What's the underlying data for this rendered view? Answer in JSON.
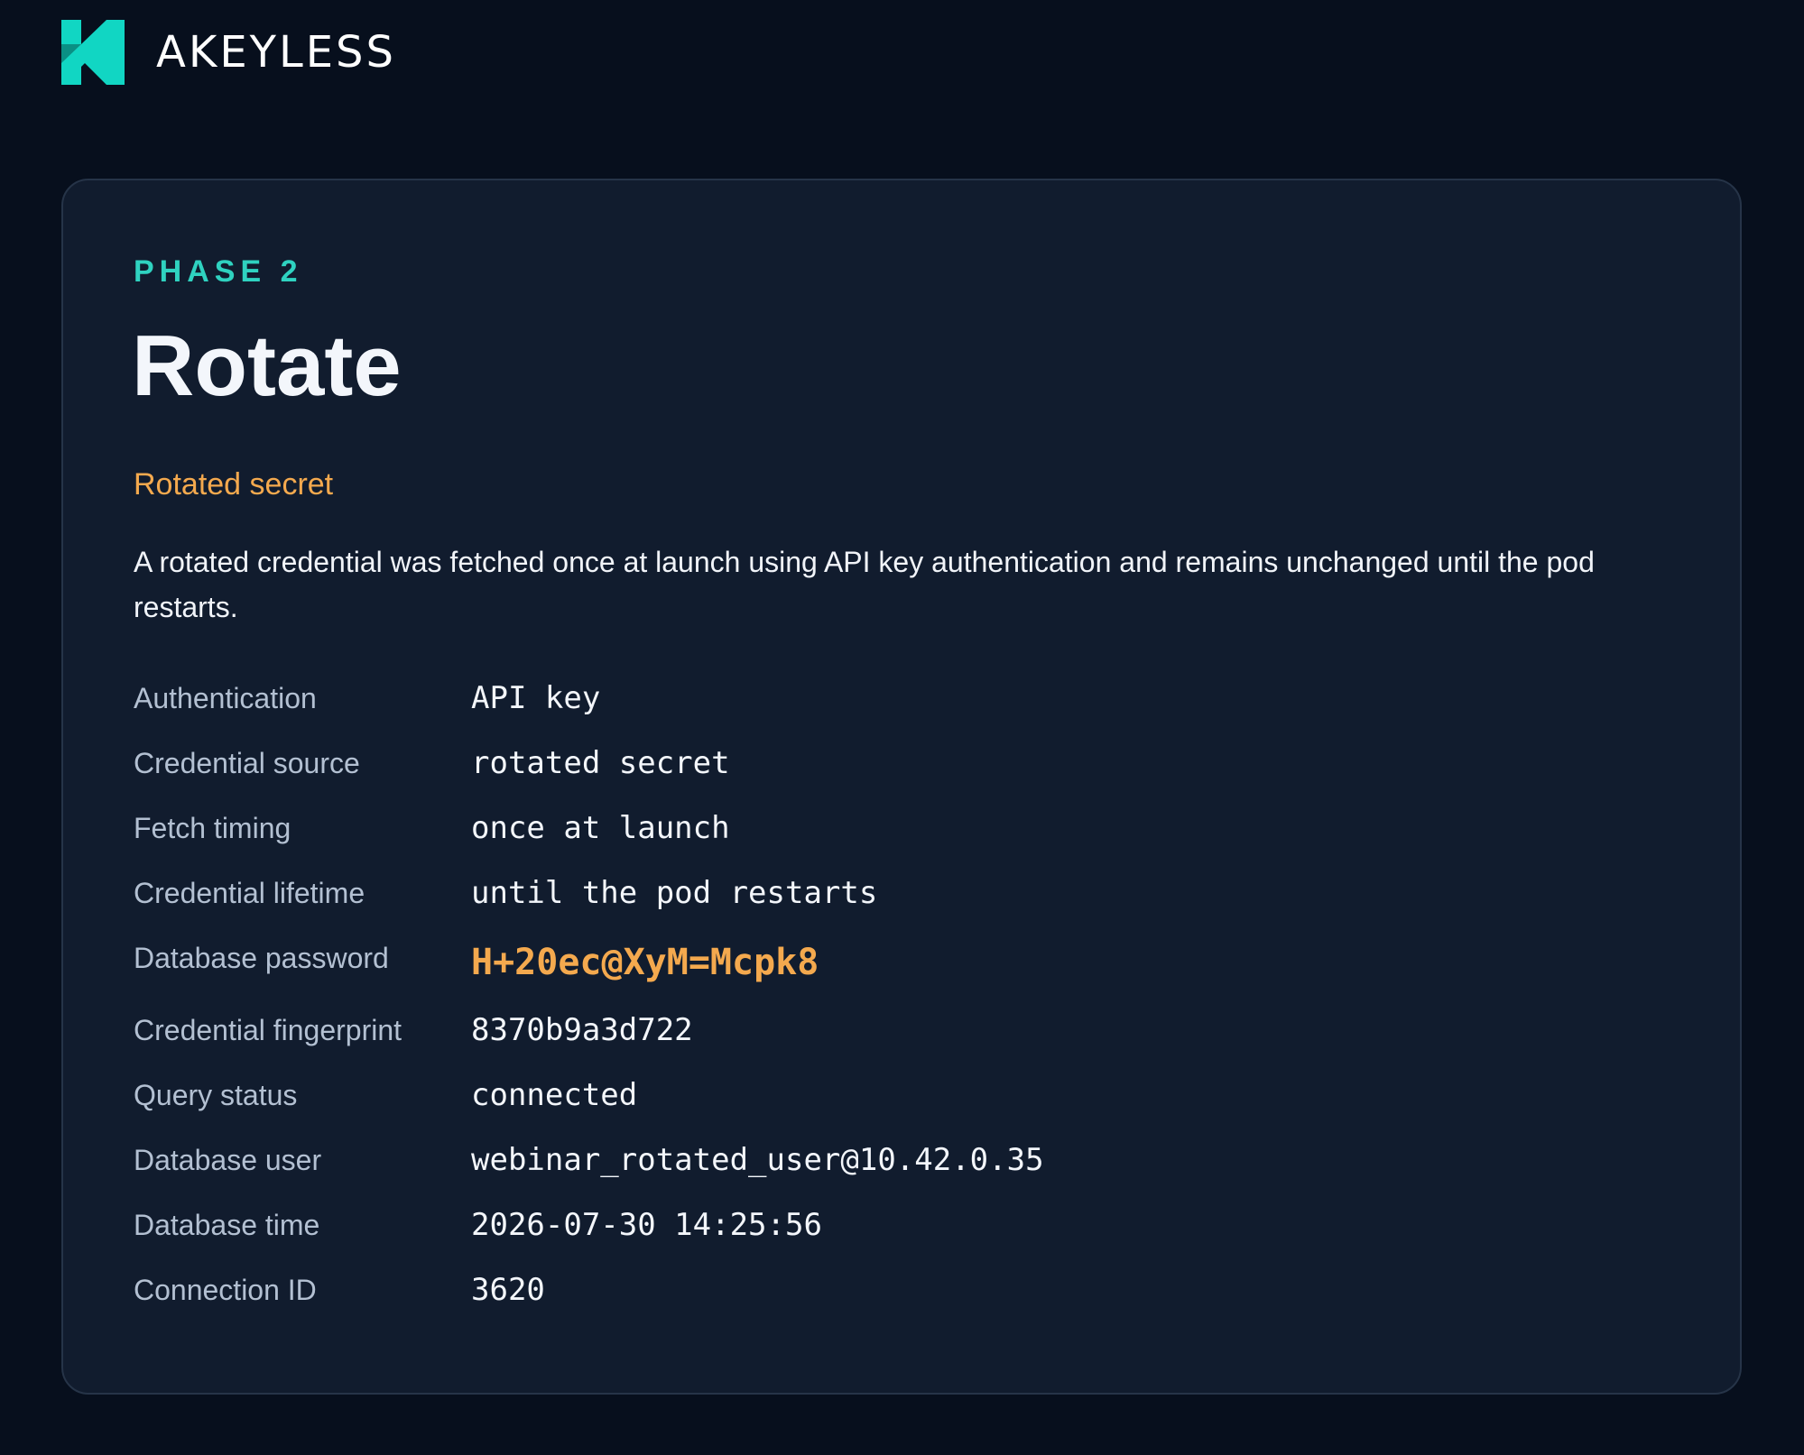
{
  "brand": {
    "name": "AKEYLESS",
    "accent_color": "#11d6c3"
  },
  "card": {
    "phase": "PHASE 2",
    "title": "Rotate",
    "subtitle": "Rotated secret",
    "description": "A rotated credential was fetched once at launch using API key authentication and remains unchanged until the pod restarts.",
    "rows": [
      {
        "label": "Authentication",
        "value": "API key"
      },
      {
        "label": "Credential source",
        "value": "rotated secret"
      },
      {
        "label": "Fetch timing",
        "value": "once at launch"
      },
      {
        "label": "Credential lifetime",
        "value": "until the pod restarts"
      },
      {
        "label": "Database password",
        "value": "H+20ec@XyM=Mcpk8"
      },
      {
        "label": "Credential fingerprint",
        "value": "8370b9a3d722"
      },
      {
        "label": "Query status",
        "value": "connected"
      },
      {
        "label": "Database user",
        "value": "webinar_rotated_user@10.42.0.35"
      },
      {
        "label": "Database time",
        "value": "2026-07-30 14:25:56"
      },
      {
        "label": "Connection ID",
        "value": "3620"
      }
    ]
  },
  "colors": {
    "background": "#070f1d",
    "card": "#111c2e",
    "phase": "#2fd2c0",
    "highlight": "#f4a94e"
  }
}
